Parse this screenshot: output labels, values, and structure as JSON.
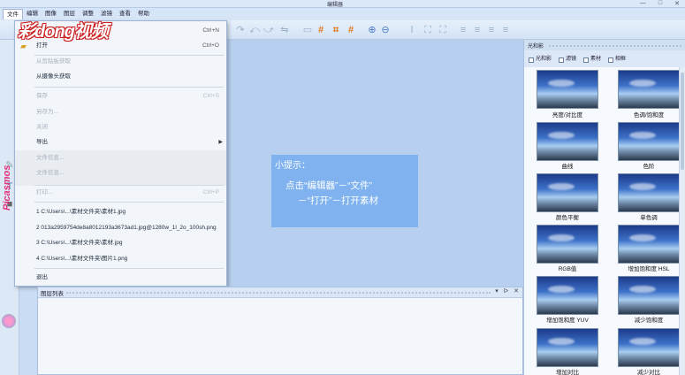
{
  "window": {
    "title": "编辑器",
    "controls": [
      "—",
      "□",
      "✕"
    ]
  },
  "menubar": [
    "文件",
    "编辑",
    "图像",
    "图层",
    "调整",
    "滤镜",
    "查看",
    "帮助"
  ],
  "brand": {
    "text_left": "ʀʃ",
    "text_mid": "ng",
    "text_right": "视频",
    "full": "彩dong视频",
    "side": "Picasmos"
  },
  "file_menu": {
    "items": [
      {
        "label": "",
        "shortcut": "Ctrl+N",
        "disabled": false
      },
      {
        "label": "打开",
        "shortcut": "Ctrl+O",
        "disabled": false
      },
      {
        "label": "从剪贴板获取",
        "shortcut": "",
        "disabled": true
      },
      {
        "label": "从摄像头获取",
        "shortcut": "",
        "disabled": false
      },
      {
        "label": "保存",
        "shortcut": "Ctrl+S",
        "disabled": true
      },
      {
        "label": "另存为...",
        "shortcut": "",
        "disabled": true
      },
      {
        "label": "关闭",
        "shortcut": "",
        "disabled": true
      },
      {
        "label": "导出",
        "shortcut": "",
        "disabled": false
      },
      {
        "label": "文件信息...",
        "shortcut": "",
        "disabled": true
      },
      {
        "label": "文件信息...",
        "shortcut": "",
        "disabled": true
      },
      {
        "label": "打印...",
        "shortcut": "Ctrl+P",
        "disabled": true
      }
    ],
    "recent": [
      "1 C:\\Users\\...\\素材文件夹\\素材1.jpg",
      "2 013a2959754de8a8012193a3673ad1.jpg@1280w_1l_2o_100sh.png",
      "3 C:\\Users\\...\\素材文件夹\\素材.jpg",
      "4 C:\\Users\\...\\素材文件夹\\图片1.png"
    ],
    "exit": "退出"
  },
  "tip": {
    "title": "小提示：",
    "line1": "点击“编辑器”－“文件”",
    "line2": "－“打开”－打开素材"
  },
  "layer_panel": {
    "title": "图层列表",
    "controls": [
      "▾",
      "ᐅ",
      "✕"
    ]
  },
  "effects_panel": {
    "title": "光和影",
    "tabs": [
      "光和影",
      "滤镜",
      "素材",
      "相框"
    ],
    "items": [
      "亮度/对比度",
      "色调/饱和度",
      "曲线",
      "色阶",
      "颜色平衡",
      "单色调",
      "RGB值",
      "增加饱和度 HSL",
      "增加饱和度 YUV",
      "减少饱和度",
      "增加对比",
      "减少对比"
    ]
  }
}
